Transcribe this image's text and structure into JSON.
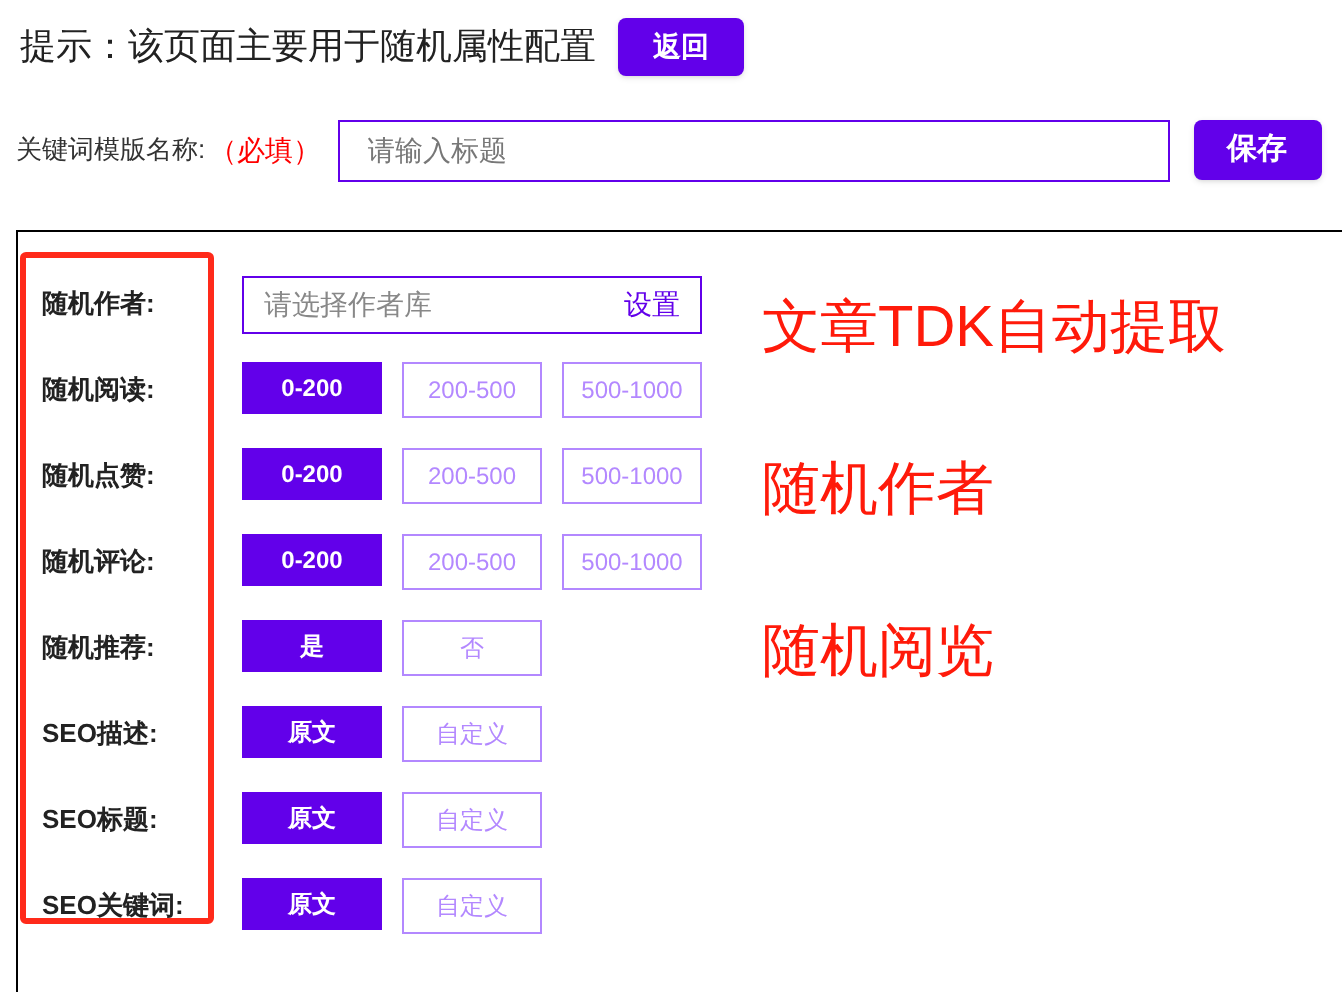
{
  "header": {
    "tip": "提示：该页面主要用于随机属性配置",
    "back_button": "返回"
  },
  "name_row": {
    "label": "关键词模版名称:",
    "required": "（必填）",
    "placeholder": "请输入标题",
    "save_button": "保存"
  },
  "settings": [
    {
      "kind": "picker",
      "label": "随机作者:",
      "placeholder": "请选择作者库",
      "action": "设置"
    },
    {
      "kind": "options",
      "label": "随机阅读:",
      "options": [
        {
          "label": "0-200",
          "selected": true
        },
        {
          "label": "200-500",
          "selected": false
        },
        {
          "label": "500-1000",
          "selected": false
        }
      ]
    },
    {
      "kind": "options",
      "label": "随机点赞:",
      "options": [
        {
          "label": "0-200",
          "selected": true
        },
        {
          "label": "200-500",
          "selected": false
        },
        {
          "label": "500-1000",
          "selected": false
        }
      ]
    },
    {
      "kind": "options",
      "label": "随机评论:",
      "options": [
        {
          "label": "0-200",
          "selected": true
        },
        {
          "label": "200-500",
          "selected": false
        },
        {
          "label": "500-1000",
          "selected": false
        }
      ]
    },
    {
      "kind": "options",
      "label": "随机推荐:",
      "options": [
        {
          "label": "是",
          "selected": true
        },
        {
          "label": "否",
          "selected": false
        }
      ]
    },
    {
      "kind": "options",
      "label": "SEO描述:",
      "options": [
        {
          "label": "原文",
          "selected": true
        },
        {
          "label": "自定义",
          "selected": false
        }
      ]
    },
    {
      "kind": "options",
      "label": "SEO标题:",
      "options": [
        {
          "label": "原文",
          "selected": true
        },
        {
          "label": "自定义",
          "selected": false
        }
      ]
    },
    {
      "kind": "options",
      "label": "SEO关键词:",
      "options": [
        {
          "label": "原文",
          "selected": true
        },
        {
          "label": "自定义",
          "selected": false
        }
      ]
    }
  ],
  "annotations": [
    "文章TDK自动提取",
    "随机作者",
    "随机阅览"
  ]
}
